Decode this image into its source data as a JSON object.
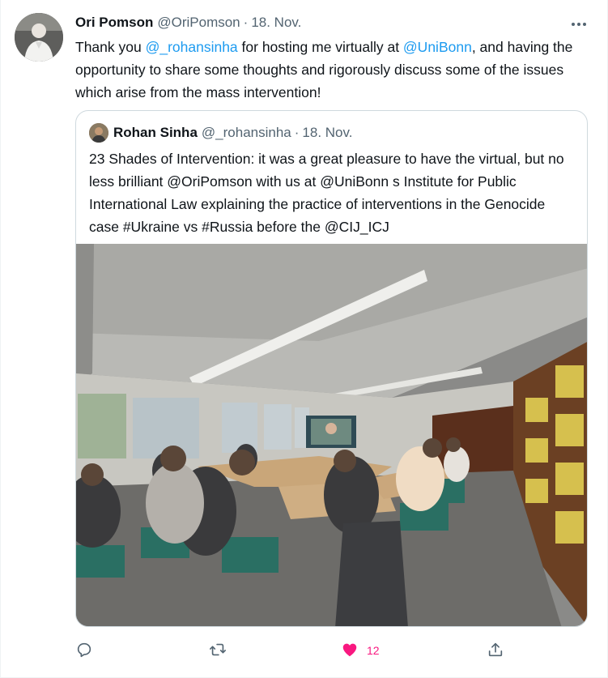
{
  "tweet": {
    "author_name": "Ori Pomson",
    "author_handle": "@OriPomson",
    "separator": "·",
    "date": "18. Nov.",
    "text_parts": [
      "Thank you ",
      "@_rohansinha",
      " for hosting me virtually at ",
      "@UniBonn",
      ", and having the opportunity to share some thoughts and rigorously discuss some of the issues which arise from the mass intervention!"
    ]
  },
  "quote": {
    "author_name": "Rohan Sinha",
    "author_handle": "@_rohansinha",
    "separator": "·",
    "date": "18. Nov.",
    "text": "23 Shades of Intervention: it was a great pleasure to have the virtual, but no less brilliant @OriPomson with us at @UniBonn s Institute for Public International Law explaining the practice of interventions in the Genocide case #Ukraine vs #Russia before the @CIJ_ICJ"
  },
  "actions": {
    "reply_count": "",
    "retweet_count": "",
    "like_count": "12",
    "liked": true
  },
  "colors": {
    "link": "#1d9bf0",
    "like": "#f91880",
    "muted": "#536471",
    "text": "#0f1419"
  },
  "icons": [
    "more-icon",
    "reply-icon",
    "retweet-icon",
    "heart-icon",
    "share-icon"
  ]
}
